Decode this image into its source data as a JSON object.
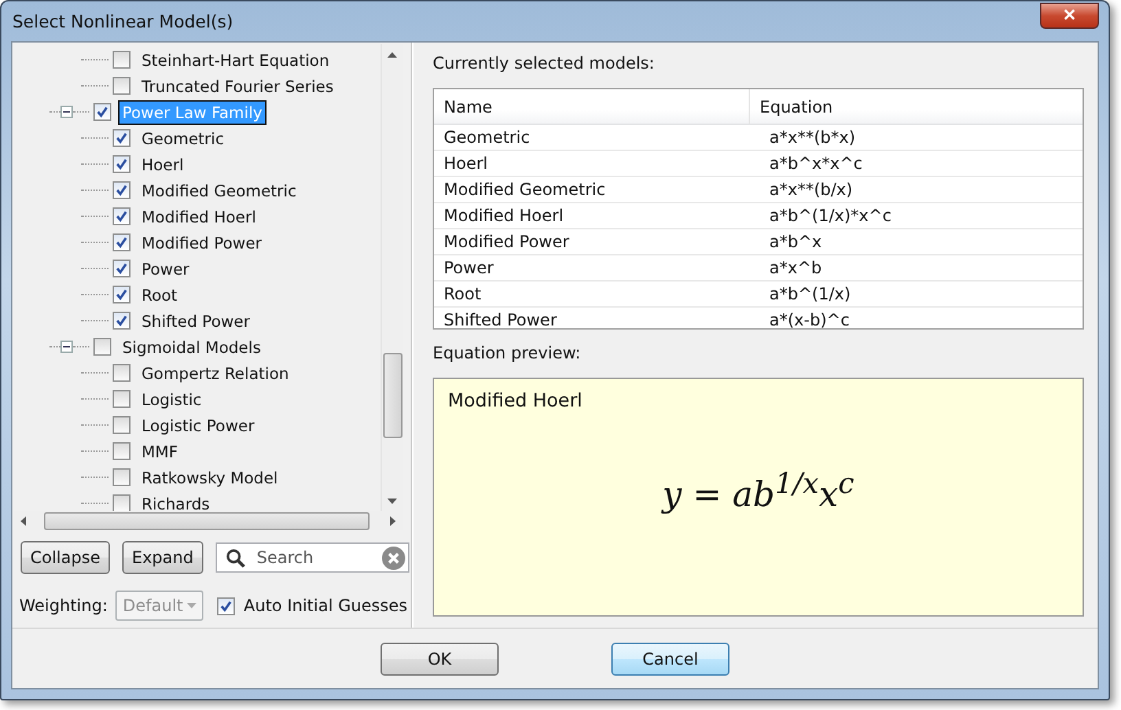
{
  "window": {
    "title": "Select Nonlinear Model(s)",
    "close": "✕"
  },
  "tree": {
    "items": [
      {
        "children": [
          {
            "label": "Steinhart-Hart Equation",
            "checked": false
          },
          {
            "label": "Truncated Fourier Series",
            "checked": false
          }
        ]
      },
      {
        "label": "Power Law Family",
        "checked": true,
        "selected": true,
        "expanded": true,
        "children": [
          {
            "label": "Geometric",
            "checked": true
          },
          {
            "label": "Hoerl",
            "checked": true
          },
          {
            "label": "Modified Geometric",
            "checked": true
          },
          {
            "label": "Modified Hoerl",
            "checked": true
          },
          {
            "label": "Modified Power",
            "checked": true
          },
          {
            "label": "Power",
            "checked": true
          },
          {
            "label": "Root",
            "checked": true
          },
          {
            "label": "Shifted Power",
            "checked": true
          }
        ]
      },
      {
        "label": "Sigmoidal Models",
        "checked": false,
        "selected": false,
        "expanded": true,
        "children": [
          {
            "label": "Gompertz Relation",
            "checked": false
          },
          {
            "label": "Logistic",
            "checked": false
          },
          {
            "label": "Logistic Power",
            "checked": false
          },
          {
            "label": "MMF",
            "checked": false
          },
          {
            "label": "Ratkowsky Model",
            "checked": false
          },
          {
            "label": "Richards",
            "checked": false
          }
        ]
      }
    ]
  },
  "buttons_left": [
    "Collapse",
    "Expand"
  ],
  "search": {
    "placeholder": "Search"
  },
  "weighting": {
    "label": "Weighting:",
    "value": "Default",
    "disabled": true
  },
  "auto_guesses": {
    "label": "Auto Initial Guesses",
    "checked": true
  },
  "selected_models": {
    "label": "Currently selected models:",
    "columns": [
      "Name",
      "Equation"
    ],
    "rows": [
      [
        "Geometric",
        "a*x**(b*x)"
      ],
      [
        "Hoerl",
        "a*b^x*x^c"
      ],
      [
        "Modified Geometric",
        "a*x**(b/x)"
      ],
      [
        "Modified Hoerl",
        "a*b^(1/x)*x^c"
      ],
      [
        "Modified Power",
        "a*b^x"
      ],
      [
        "Power",
        "a*x^b"
      ],
      [
        "Root",
        "a*b^(1/x)"
      ],
      [
        "Shifted Power",
        "a*(x-b)^c"
      ]
    ]
  },
  "preview": {
    "label": "Equation preview:",
    "title": "Modified Hoerl",
    "equation": "y = ab$^{1/x}$x$^{c}$"
  },
  "buttons": [
    {
      "label": "OK",
      "default": false
    },
    {
      "label": "Cancel",
      "default": true
    }
  ]
}
